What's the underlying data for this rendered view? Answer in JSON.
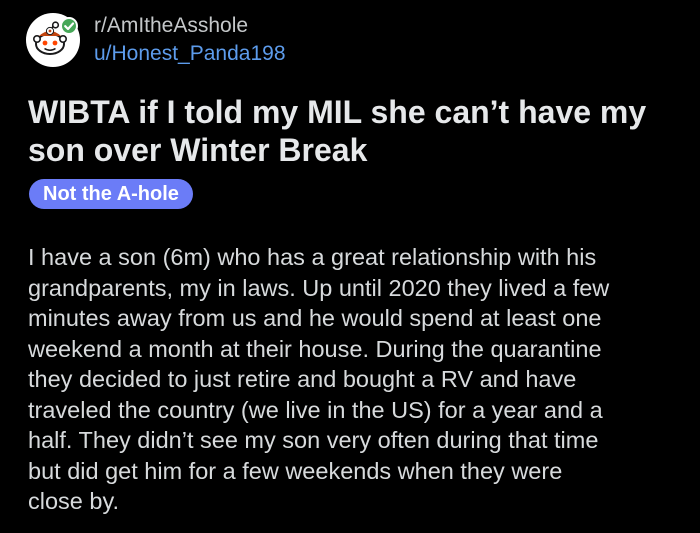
{
  "post": {
    "subreddit": "r/AmItheAsshole",
    "author": "u/Honest_Panda198",
    "title_lines": [
      "WIBTA if I told my MIL she can’t have my",
      "son over Winter Break"
    ],
    "flair": "Not the A-hole",
    "body_lines": [
      "I have a son (6m) who has a great relationship with his",
      "grandparents, my in laws. Up until 2020 they lived a few",
      "minutes away from us and he would spend at least one",
      "weekend a month at their house. During the quarantine",
      "they decided to just retire and bought a RV and have",
      "traveled the country (we live in the US) for a year and a",
      "half. They didn’t see my son very often during that time",
      "but did get him for a few weekends when they were",
      "close by."
    ]
  },
  "colors": {
    "background": "#000000",
    "username": "#5d9cec",
    "flair_bg": "#6b7cf7",
    "online_badge": "#46a758"
  },
  "icons": {
    "avatar": "reddit-snoo-avatar-icon",
    "badge": "checkmark-badge-icon"
  }
}
